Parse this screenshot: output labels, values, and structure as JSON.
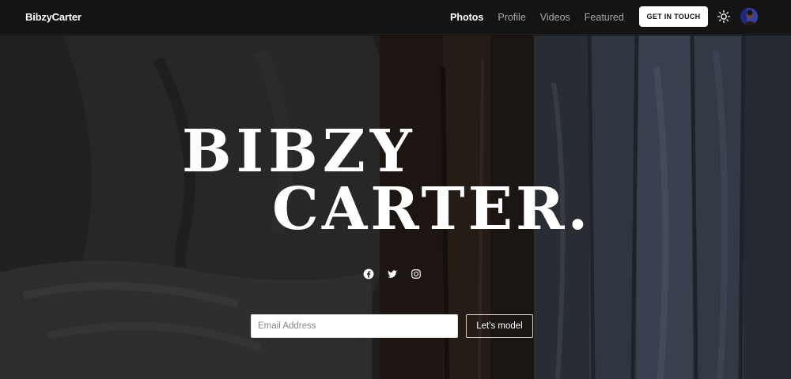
{
  "brand": "BibzyCarter",
  "nav": {
    "links": [
      "Photos",
      "Profile",
      "Videos",
      "Featured"
    ],
    "active": "Photos",
    "cta_label": "GET IN TOUCH",
    "theme_icon": "sun-icon",
    "avatar_icon": "avatar"
  },
  "hero": {
    "title_line1": "BIBZY",
    "title_line2": "CARTER.",
    "socials": [
      "facebook-icon",
      "twitter-icon",
      "instagram-icon"
    ]
  },
  "signup": {
    "email_placeholder": "Email Address",
    "email_value": "",
    "button_label": "Let's model"
  },
  "colors": {
    "nav_bg": "#141414",
    "text": "#ffffff",
    "muted": "#a9a9a9"
  }
}
